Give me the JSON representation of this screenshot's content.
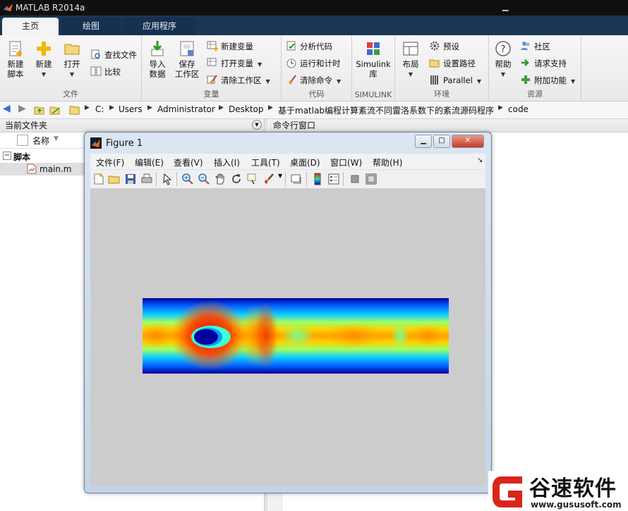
{
  "app": {
    "title": "MATLAB R2014a"
  },
  "tabs": [
    {
      "label": "主页",
      "active": true
    },
    {
      "label": "绘图",
      "active": false
    },
    {
      "label": "应用程序",
      "active": false
    }
  ],
  "ribbon": {
    "file": {
      "section_label": "文件",
      "new_script": {
        "line1": "新建",
        "line2": "脚本"
      },
      "new": "新建",
      "open": "打开",
      "find_files": "查找文件",
      "compare": "比较"
    },
    "variable": {
      "section_label": "变量",
      "import": {
        "line1": "导入",
        "line2": "数据"
      },
      "save": {
        "line1": "保存",
        "line2": "工作区"
      },
      "new_variable": "新建变量",
      "open_variable": "打开变量",
      "clear_workspace": "清除工作区"
    },
    "code": {
      "section_label": "代码",
      "analyze": "分析代码",
      "run_time": "运行和计时",
      "clear_commands": "清除命令"
    },
    "simulink": {
      "section_label": "SIMULINK",
      "library": {
        "line1": "Simulink",
        "line2": "库"
      }
    },
    "environment": {
      "section_label": "环境",
      "layout": "布局",
      "preferences": "预设",
      "set_path": "设置路径",
      "parallel": "Parallel"
    },
    "resources": {
      "section_label": "资源",
      "help": "帮助",
      "community": "社区",
      "request_support": "请求支持",
      "addons": "附加功能"
    }
  },
  "address": {
    "crumbs": [
      "C:",
      "Users",
      "Administrator",
      "Desktop",
      "基于matlab编程计算紊流不同雷洛系数下的紊流源码程序",
      "code"
    ]
  },
  "current_folder": {
    "title": "当前文件夹",
    "column_name": "名称",
    "group": "脚本",
    "files": [
      "main.m"
    ]
  },
  "command_window": {
    "title": "命令行窗口"
  },
  "figure": {
    "title": "Figure 1",
    "menus": [
      "文件(F)",
      "编辑(E)",
      "查看(V)",
      "插入(I)",
      "工具(T)",
      "桌面(D)",
      "窗口(W)",
      "帮助(H)"
    ]
  },
  "watermark": {
    "brand": "谷速软件",
    "url": "www.gususoft.com",
    "brand_color": "#d9251c"
  },
  "colors": {
    "titlebar": "#101010",
    "tabstrip": "#1b3554",
    "figure_bg": "#cccccc"
  }
}
